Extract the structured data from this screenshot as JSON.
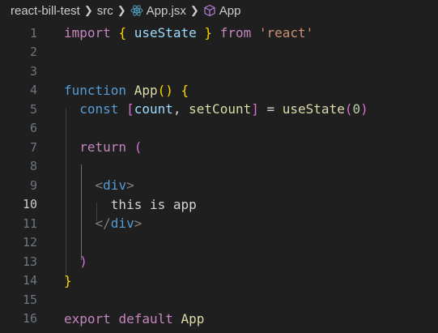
{
  "breadcrumb": {
    "project": "react-bill-test",
    "folder": "src",
    "file": "App.jsx",
    "symbol": "App",
    "file_icon": "react-icon",
    "symbol_icon": "cube-icon"
  },
  "editor": {
    "active_line": 10,
    "lines": [
      {
        "n": "1",
        "tokens": [
          {
            "t": "import",
            "c": "kw"
          },
          {
            "t": " ",
            "c": "txt"
          },
          {
            "t": "{",
            "c": "b1"
          },
          {
            "t": " useState ",
            "c": "var"
          },
          {
            "t": "}",
            "c": "b1"
          },
          {
            "t": " ",
            "c": "txt"
          },
          {
            "t": "from",
            "c": "kw"
          },
          {
            "t": " ",
            "c": "txt"
          },
          {
            "t": "'react'",
            "c": "str"
          }
        ]
      },
      {
        "n": "2",
        "tokens": []
      },
      {
        "n": "3",
        "tokens": []
      },
      {
        "n": "4",
        "tokens": [
          {
            "t": "function",
            "c": "kw2"
          },
          {
            "t": " ",
            "c": "txt"
          },
          {
            "t": "App",
            "c": "fn"
          },
          {
            "t": "()",
            "c": "b1"
          },
          {
            "t": " ",
            "c": "txt"
          },
          {
            "t": "{",
            "c": "b1"
          }
        ]
      },
      {
        "n": "5",
        "tokens": [
          {
            "t": "  const",
            "c": "kw2"
          },
          {
            "t": " ",
            "c": "txt"
          },
          {
            "t": "[",
            "c": "b2"
          },
          {
            "t": "count",
            "c": "var"
          },
          {
            "t": ", ",
            "c": "txt"
          },
          {
            "t": "setCount",
            "c": "fn"
          },
          {
            "t": "]",
            "c": "b2"
          },
          {
            "t": " = ",
            "c": "txt"
          },
          {
            "t": "useState",
            "c": "fn"
          },
          {
            "t": "(",
            "c": "b2"
          },
          {
            "t": "0",
            "c": "num"
          },
          {
            "t": ")",
            "c": "b2"
          }
        ]
      },
      {
        "n": "6",
        "tokens": []
      },
      {
        "n": "7",
        "tokens": [
          {
            "t": "  return",
            "c": "kw"
          },
          {
            "t": " ",
            "c": "txt"
          },
          {
            "t": "(",
            "c": "b2"
          }
        ]
      },
      {
        "n": "8",
        "tokens": []
      },
      {
        "n": "9",
        "tokens": [
          {
            "t": "    <",
            "c": "punc"
          },
          {
            "t": "div",
            "c": "tag"
          },
          {
            "t": ">",
            "c": "punc"
          }
        ]
      },
      {
        "n": "10",
        "tokens": [
          {
            "t": "      this is app",
            "c": "txt"
          }
        ]
      },
      {
        "n": "11",
        "tokens": [
          {
            "t": "    </",
            "c": "punc"
          },
          {
            "t": "div",
            "c": "tag"
          },
          {
            "t": ">",
            "c": "punc"
          }
        ]
      },
      {
        "n": "12",
        "tokens": []
      },
      {
        "n": "13",
        "tokens": [
          {
            "t": "  )",
            "c": "b2"
          }
        ]
      },
      {
        "n": "14",
        "tokens": [
          {
            "t": "}",
            "c": "b1"
          }
        ]
      },
      {
        "n": "15",
        "tokens": []
      },
      {
        "n": "16",
        "tokens": [
          {
            "t": "export",
            "c": "kw"
          },
          {
            "t": " ",
            "c": "txt"
          },
          {
            "t": "default",
            "c": "kw"
          },
          {
            "t": " ",
            "c": "txt"
          },
          {
            "t": "App",
            "c": "fn"
          }
        ]
      }
    ]
  }
}
